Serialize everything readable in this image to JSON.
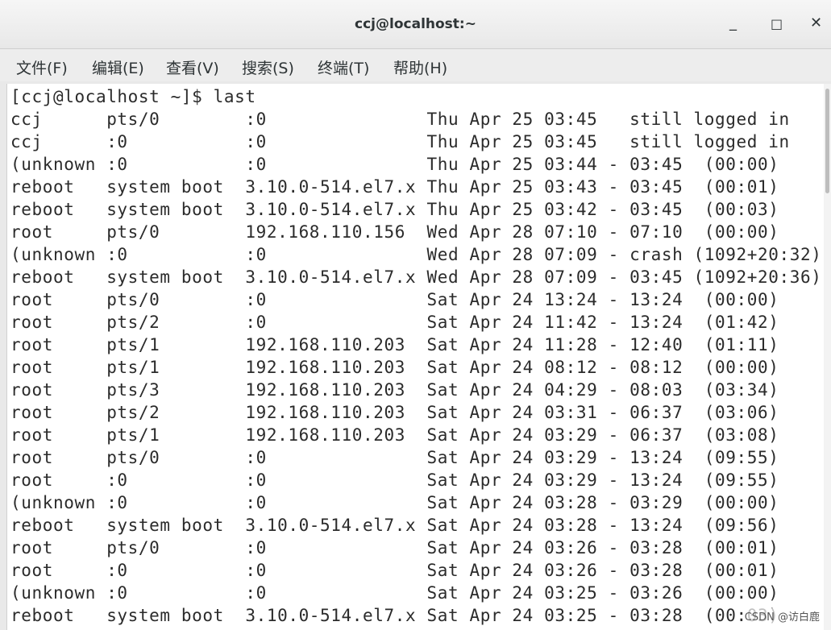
{
  "window": {
    "title": "ccj@localhost:~",
    "minimize_glyph": "_",
    "maximize_glyph": "□",
    "close_glyph": "✕"
  },
  "menu": {
    "items": [
      "文件(F)",
      "编辑(E)",
      "查看(V)",
      "搜索(S)",
      "终端(T)",
      "帮助(H)"
    ]
  },
  "terminal": {
    "prompt": "[ccj@localhost ~]$ last",
    "lines": [
      "ccj      pts/0        :0               Thu Apr 25 03:45   still logged in",
      "ccj      :0           :0               Thu Apr 25 03:45   still logged in",
      "(unknown :0           :0               Thu Apr 25 03:44 - 03:45  (00:00)",
      "reboot   system boot  3.10.0-514.el7.x Thu Apr 25 03:43 - 03:45  (00:01)",
      "reboot   system boot  3.10.0-514.el7.x Thu Apr 25 03:42 - 03:45  (00:03)",
      "root     pts/0        192.168.110.156  Wed Apr 28 07:10 - 07:10  (00:00)",
      "(unknown :0           :0               Wed Apr 28 07:09 - crash (1092+20:32)",
      "reboot   system boot  3.10.0-514.el7.x Wed Apr 28 07:09 - 03:45 (1092+20:36)",
      "root     pts/0        :0               Sat Apr 24 13:24 - 13:24  (00:00)",
      "root     pts/2        :0               Sat Apr 24 11:42 - 13:24  (01:42)",
      "root     pts/1        192.168.110.203  Sat Apr 24 11:28 - 12:40  (01:11)",
      "root     pts/1        192.168.110.203  Sat Apr 24 08:12 - 08:12  (00:00)",
      "root     pts/3        192.168.110.203  Sat Apr 24 04:29 - 08:03  (03:34)",
      "root     pts/2        192.168.110.203  Sat Apr 24 03:31 - 06:37  (03:06)",
      "root     pts/1        192.168.110.203  Sat Apr 24 03:29 - 06:37  (03:08)",
      "root     pts/0        :0               Sat Apr 24 03:29 - 13:24  (09:55)",
      "root     :0           :0               Sat Apr 24 03:29 - 13:24  (09:55)",
      "(unknown :0           :0               Sat Apr 24 03:28 - 03:29  (00:00)",
      "reboot   system boot  3.10.0-514.el7.x Sat Apr 24 03:28 - 13:24  (09:56)",
      "root     pts/0        :0               Sat Apr 24 03:26 - 03:28  (00:01)",
      "root     :0           :0               Sat Apr 24 03:26 - 03:28  (00:01)",
      "(unknown :0           :0               Sat Apr 24 03:25 - 03:26  (00:00)",
      "reboot   system boot  3.10.0-514.el7.x Sat Apr 24 03:25 - 03:28  (00:03)"
    ]
  },
  "watermark": "CSDN @访白鹿"
}
